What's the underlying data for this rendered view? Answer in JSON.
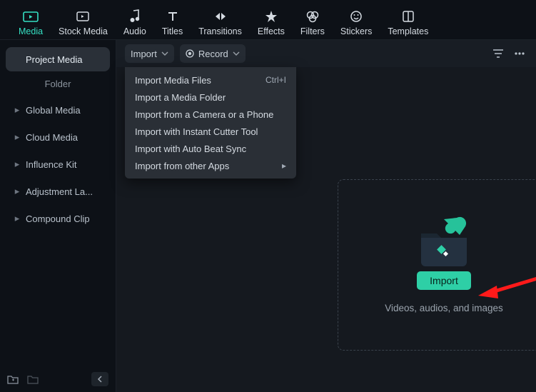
{
  "topTabs": [
    {
      "label": "Media",
      "active": true
    },
    {
      "label": "Stock Media"
    },
    {
      "label": "Audio"
    },
    {
      "label": "Titles"
    },
    {
      "label": "Transitions"
    },
    {
      "label": "Effects"
    },
    {
      "label": "Filters"
    },
    {
      "label": "Stickers"
    },
    {
      "label": "Templates"
    }
  ],
  "sidebar": {
    "items": [
      {
        "label": "Project Media",
        "selected": true,
        "hasChevron": false
      },
      {
        "label": "Folder",
        "isFolder": true
      },
      {
        "label": "Global Media",
        "hasChevron": true
      },
      {
        "label": "Cloud Media",
        "hasChevron": true
      },
      {
        "label": "Influence Kit",
        "hasChevron": true
      },
      {
        "label": "Adjustment La...",
        "hasChevron": true
      },
      {
        "label": "Compound Clip",
        "hasChevron": true
      }
    ]
  },
  "toolbar": {
    "import_label": "Import",
    "record_label": "Record"
  },
  "dropdown": {
    "items": [
      {
        "label": "Import Media Files",
        "shortcut": "Ctrl+I"
      },
      {
        "label": "Import a Media Folder"
      },
      {
        "label": "Import from a Camera or a Phone"
      },
      {
        "label": "Import with Instant Cutter Tool"
      },
      {
        "label": "Import with Auto Beat Sync"
      },
      {
        "label": "Import from other Apps",
        "submenu": true
      }
    ]
  },
  "dropzone": {
    "button_label": "Import",
    "hint": "Videos, audios, and images"
  },
  "accent": "#35e0c3"
}
